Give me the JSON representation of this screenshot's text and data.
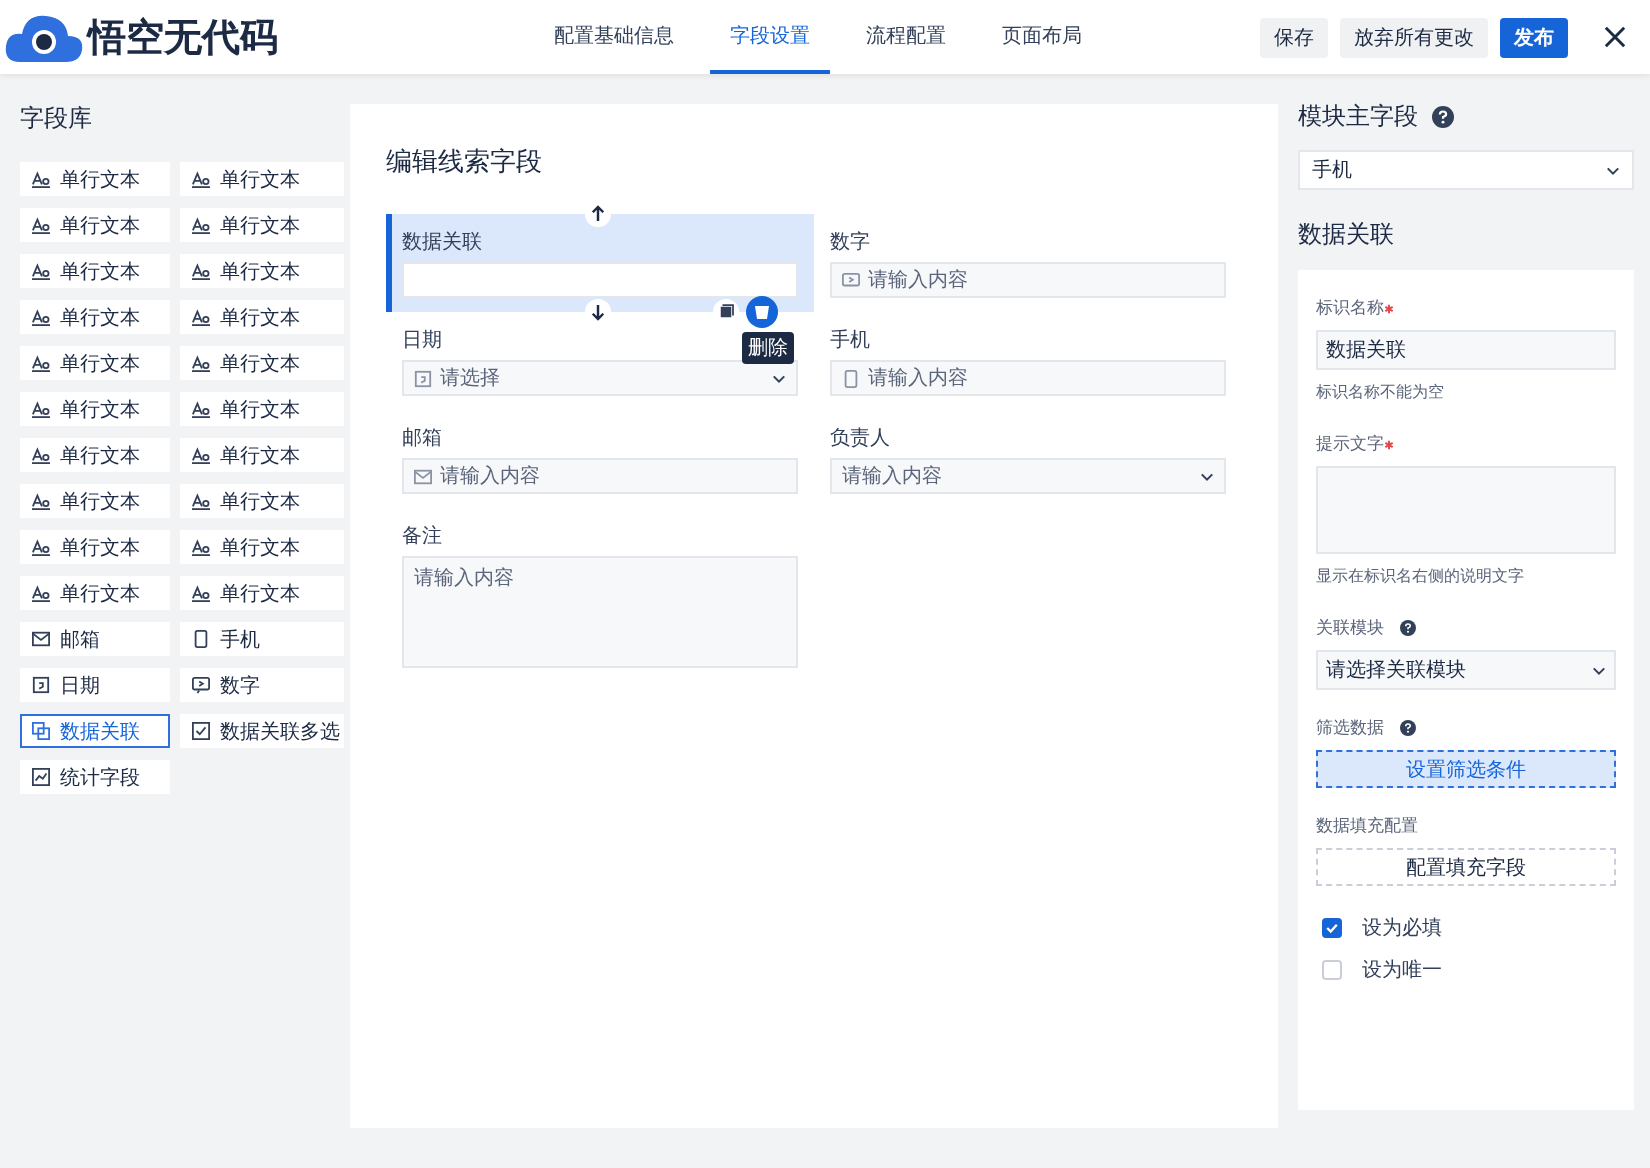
{
  "header": {
    "logo": "悟空无代码",
    "tabs": [
      {
        "label": "配置基础信息",
        "selected": false
      },
      {
        "label": "字段设置",
        "selected": true
      },
      {
        "label": "流程配置",
        "selected": false
      },
      {
        "label": "页面布局",
        "selected": false
      }
    ],
    "buttons": [
      {
        "label": "保存",
        "kind": "secondary"
      },
      {
        "label": "放弃所有更改",
        "kind": "secondary"
      },
      {
        "label": "发布",
        "kind": "primary"
      }
    ]
  },
  "library": {
    "title": "字段库",
    "items": [
      {
        "label": "单行文本",
        "kind": "text",
        "selected": false
      },
      {
        "label": "单行文本",
        "kind": "text",
        "selected": false
      },
      {
        "label": "单行文本",
        "kind": "text",
        "selected": false
      },
      {
        "label": "单行文本",
        "kind": "text",
        "selected": false
      },
      {
        "label": "单行文本",
        "kind": "text",
        "selected": false
      },
      {
        "label": "单行文本",
        "kind": "text",
        "selected": false
      },
      {
        "label": "单行文本",
        "kind": "text",
        "selected": false
      },
      {
        "label": "单行文本",
        "kind": "text",
        "selected": false
      },
      {
        "label": "单行文本",
        "kind": "text",
        "selected": false
      },
      {
        "label": "单行文本",
        "kind": "text",
        "selected": false
      },
      {
        "label": "单行文本",
        "kind": "text",
        "selected": false
      },
      {
        "label": "单行文本",
        "kind": "text",
        "selected": false
      },
      {
        "label": "单行文本",
        "kind": "text",
        "selected": false
      },
      {
        "label": "单行文本",
        "kind": "text",
        "selected": false
      },
      {
        "label": "单行文本",
        "kind": "text",
        "selected": false
      },
      {
        "label": "单行文本",
        "kind": "text",
        "selected": false
      },
      {
        "label": "单行文本",
        "kind": "text",
        "selected": false
      },
      {
        "label": "单行文本",
        "kind": "text",
        "selected": false
      },
      {
        "label": "单行文本",
        "kind": "text",
        "selected": false
      },
      {
        "label": "单行文本",
        "kind": "text",
        "selected": false
      },
      {
        "label": "邮箱",
        "kind": "mail",
        "selected": false
      },
      {
        "label": "手机",
        "kind": "phone",
        "selected": false
      },
      {
        "label": "日期",
        "kind": "date",
        "selected": false
      },
      {
        "label": "数字",
        "kind": "number",
        "selected": false
      },
      {
        "label": "数据关联",
        "kind": "relation",
        "selected": true
      },
      {
        "label": "数据关联多选",
        "kind": "check",
        "selected": false
      },
      {
        "label": "统计字段",
        "kind": "stat",
        "selected": false
      }
    ]
  },
  "editor": {
    "title": "编辑线索字段",
    "fields": [
      {
        "label": "数据关联",
        "kind": "relation",
        "selected": true,
        "tooltip": "删除"
      },
      {
        "label": "数字",
        "kind": "number",
        "placeholder": "请输入内容",
        "selected": false
      },
      {
        "label": "日期",
        "kind": "date",
        "placeholder": "请选择",
        "selected": false
      },
      {
        "label": "手机",
        "kind": "phone",
        "placeholder": "请输入内容",
        "selected": false
      },
      {
        "label": "邮箱",
        "kind": "mail",
        "placeholder": "请输入内容",
        "selected": false
      },
      {
        "label": "负责人",
        "kind": "user",
        "placeholder": "请输入内容",
        "selected": false
      },
      {
        "label": "备注",
        "kind": "remark",
        "placeholder": "请输入内容",
        "selected": false
      }
    ]
  },
  "settings": {
    "main_field": {
      "label": "模块主字段",
      "value": "手机"
    },
    "section_title": "数据关联",
    "name": {
      "label": "标识名称",
      "required": true,
      "value": "数据关联",
      "hint": "标识名称不能为空"
    },
    "tip": {
      "label": "提示文字",
      "required": true,
      "hint": "显示在标识名右侧的说明文字"
    },
    "module": {
      "label": "关联模块",
      "help": true,
      "placeholder": "请选择关联模块"
    },
    "filter": {
      "label": "筛选数据",
      "help": true,
      "button": "设置筛选条件"
    },
    "fill": {
      "label": "数据填充配置",
      "button": "配置填充字段"
    },
    "options": [
      {
        "label": "设为必填",
        "checked": true
      },
      {
        "label": "设为唯一",
        "checked": false
      }
    ]
  }
}
